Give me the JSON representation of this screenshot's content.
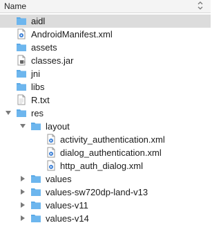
{
  "header": {
    "name_label": "Name"
  },
  "rows": [
    {
      "label": "aidl"
    },
    {
      "label": "AndroidManifest.xml"
    },
    {
      "label": "assets"
    },
    {
      "label": "classes.jar"
    },
    {
      "label": "jni"
    },
    {
      "label": "libs"
    },
    {
      "label": "R.txt"
    },
    {
      "label": "res"
    },
    {
      "label": "layout"
    },
    {
      "label": "activity_authentication.xml"
    },
    {
      "label": "dialog_authentication.xml"
    },
    {
      "label": "http_auth_dialog.xml"
    },
    {
      "label": "values"
    },
    {
      "label": "values-sw720dp-land-v13"
    },
    {
      "label": "values-v11"
    },
    {
      "label": "values-v14"
    }
  ],
  "colors": {
    "folder": "#5aa9e6",
    "folder_tab": "#4a98d6",
    "selection": "#dcdcdc"
  }
}
